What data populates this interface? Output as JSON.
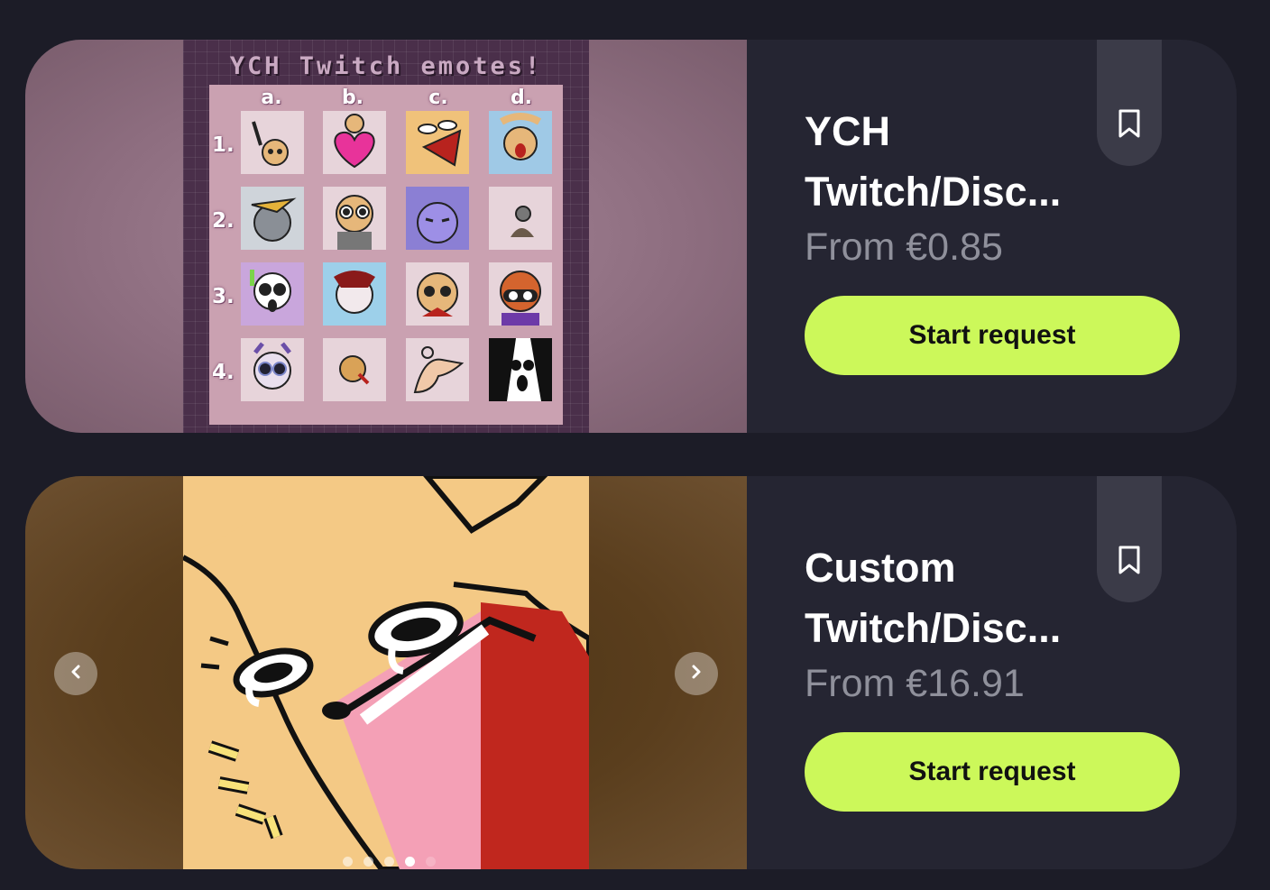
{
  "listings": [
    {
      "title_line1": "YCH",
      "title_line2": "Twitch/Disc...",
      "price": "From €0.85",
      "cta_label": "Start request",
      "image": {
        "sheet_title": "YCH Twitch emotes!",
        "columns": [
          "a.",
          "b.",
          "c.",
          "d."
        ],
        "rows": [
          "1.",
          "2.",
          "3.",
          "4."
        ]
      }
    },
    {
      "title_line1": "Custom",
      "title_line2": "Twitch/Disc...",
      "price": "From €16.91",
      "cta_label": "Start request",
      "carousel": {
        "total_dots": 5,
        "active_index": 3
      }
    }
  ],
  "icons": {
    "bookmark": "bookmark-icon",
    "prev": "chevron-left-icon",
    "next": "chevron-right-icon"
  },
  "colors": {
    "background": "#1c1c27",
    "card": "#252532",
    "accent": "#ccf85a",
    "price": "#8f909b"
  }
}
